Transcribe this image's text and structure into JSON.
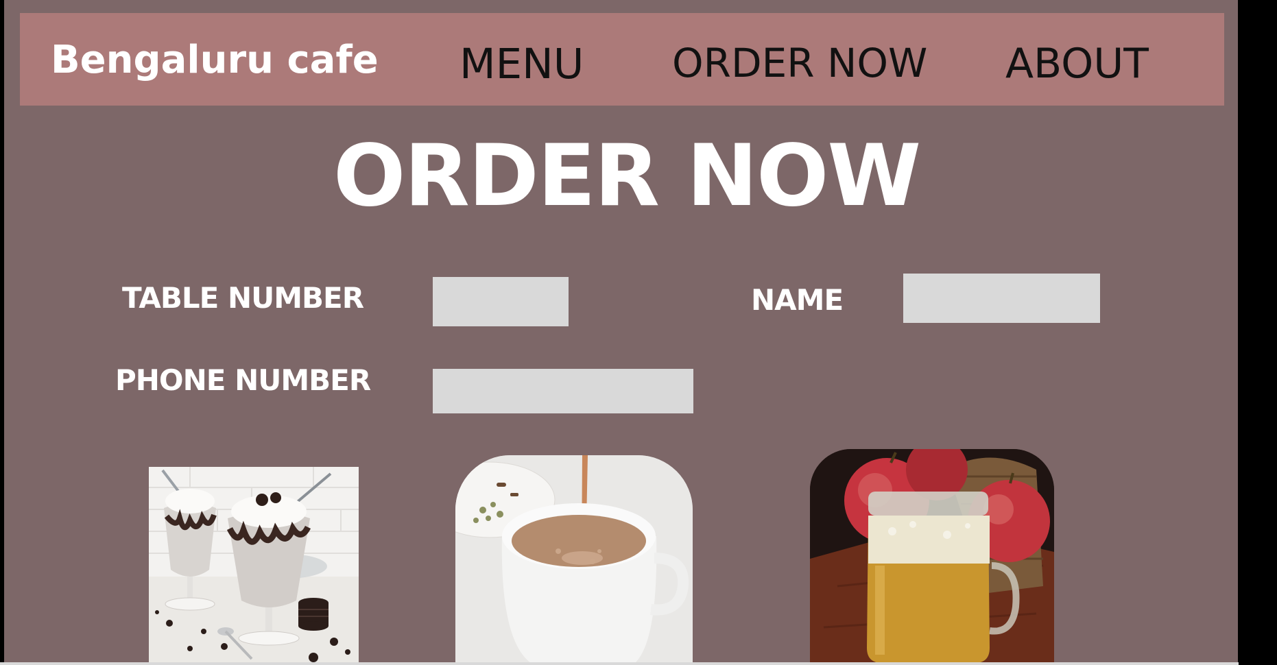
{
  "header": {
    "brand": "Bengaluru cafe",
    "nav": {
      "menu": "MENU",
      "order_now": "ORDER NOW",
      "about": "ABOUT"
    }
  },
  "main": {
    "title": "ORDER NOW",
    "form": {
      "table_number_label": "TABLE NUMBER",
      "name_label": "NAME",
      "phone_number_label": "PHONE NUMBER",
      "table_number_value": "",
      "name_value": "",
      "phone_number_value": ""
    },
    "items": [
      {
        "name": "oreo milkshake"
      },
      {
        "name": "masala chai"
      },
      {
        "name": "apple juice"
      }
    ]
  },
  "colors": {
    "page_background": "#7d6768",
    "navbar_background": "#ac7a79",
    "input_background": "#d9d9d9",
    "title_text": "#ffffff",
    "nav_text": "#111111"
  }
}
